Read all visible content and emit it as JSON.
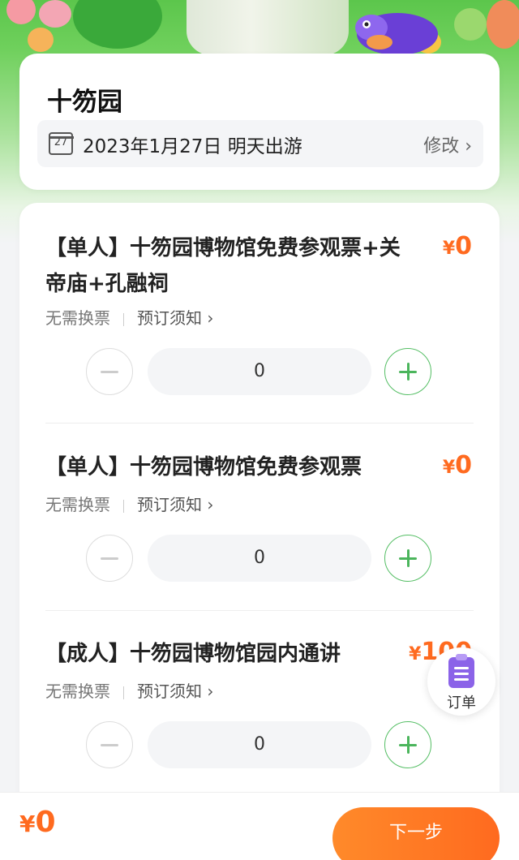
{
  "header": {
    "place_name": "十笏园",
    "date_text": "2023年1月27日  明天出游",
    "calendar_day": "27",
    "modify_label": "修改 ›"
  },
  "tickets": [
    {
      "title": "【单人】十笏园博物馆免费参观票+关帝庙+孔融祠",
      "currency": "¥",
      "price": "0",
      "exchange_note": "无需换票",
      "notice_label": "预订须知 ›",
      "quantity": "0"
    },
    {
      "title": "【单人】十笏园博物馆免费参观票",
      "currency": "¥",
      "price": "0",
      "exchange_note": "无需换票",
      "notice_label": "预订须知 ›",
      "quantity": "0"
    },
    {
      "title": "【成人】十笏园博物馆园内通讲",
      "currency": "¥",
      "price": "100",
      "exchange_note": "无需换票",
      "notice_label": "预订须知 ›",
      "quantity": "0"
    }
  ],
  "floating": {
    "orders_label": "订单"
  },
  "footer": {
    "currency": "¥",
    "total": "0",
    "next_label": "下一步"
  },
  "colors": {
    "accent_orange": "#ff6a1f",
    "accent_green": "#4bb55c",
    "banner_green": "#5cc64c",
    "orders_purple": "#8b63e8"
  }
}
